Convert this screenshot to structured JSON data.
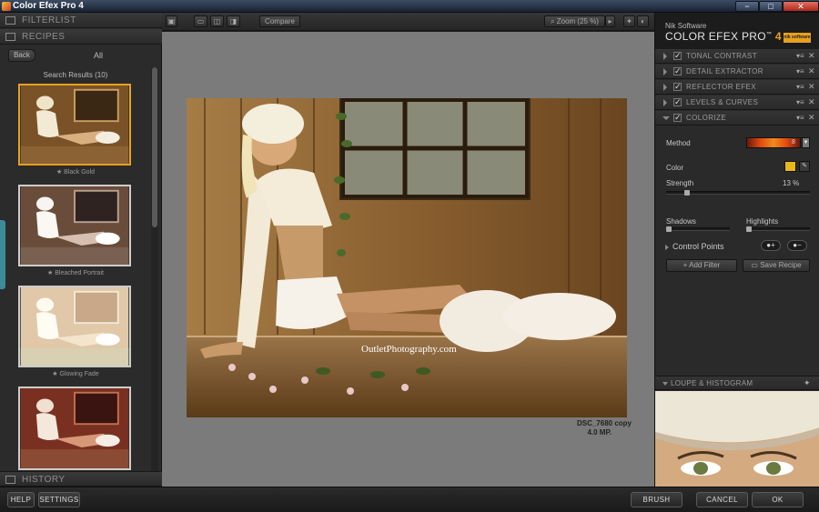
{
  "window": {
    "title": "Color Efex Pro 4",
    "minimize": "−",
    "maximize": "□",
    "close": "✕"
  },
  "left_panel": {
    "filterlist_header": "FILTERLIST",
    "recipes_header": "RECIPES",
    "back_label": "Back",
    "category_label": "All",
    "search_results": "Search Results (10)",
    "recipes": [
      {
        "name": "★ Black Gold"
      },
      {
        "name": "★ Bleached Portrait"
      },
      {
        "name": "★ Glowing Fade"
      }
    ],
    "history_header": "HISTORY"
  },
  "toolbar": {
    "compare_label": "Compare",
    "zoom_label": "Zoom (25 %)"
  },
  "canvas": {
    "watermark": "OutletPhotography.com",
    "filename": "DSC_7680 copy",
    "megapixels": "4.0 MP."
  },
  "right_panel": {
    "vendor": "Nik Software",
    "product": "COLOR EFEX PRO",
    "trademark": "™",
    "version": "4",
    "logo_text": "nik software",
    "filters": [
      {
        "name": "TONAL CONTRAST",
        "checked": true,
        "expanded": false
      },
      {
        "name": "DETAIL EXTRACTOR",
        "checked": true,
        "expanded": false
      },
      {
        "name": "REFLECTOR EFEX",
        "checked": true,
        "expanded": false
      },
      {
        "name": "LEVELS & CURVES",
        "checked": true,
        "expanded": false
      },
      {
        "name": "COLORIZE",
        "checked": true,
        "expanded": true
      }
    ],
    "colorize": {
      "method_label": "Method",
      "method_value": "8",
      "color_label": "Color",
      "color_hex": "#e8b818",
      "strength_label": "Strength",
      "strength_value": "13",
      "strength_unit": "%",
      "strength_fraction": 0.13,
      "shadows_label": "Shadows",
      "shadows_fraction": 0.0,
      "highlights_label": "Highlights",
      "highlights_fraction": 0.0
    },
    "control_points_label": "Control Points",
    "add_filter_label": "Add Filter",
    "save_recipe_label": "Save Recipe",
    "loupe_label": "LOUPE & HISTOGRAM"
  },
  "bottom_bar": {
    "help_label": "HELP",
    "settings_label": "SETTINGS",
    "brush_label": "BRUSH",
    "cancel_label": "CANCEL",
    "ok_label": "OK"
  },
  "colors": {
    "accent": "#e8a020",
    "panel": "#2a2a2a",
    "canvas": "#7b7b7b"
  }
}
